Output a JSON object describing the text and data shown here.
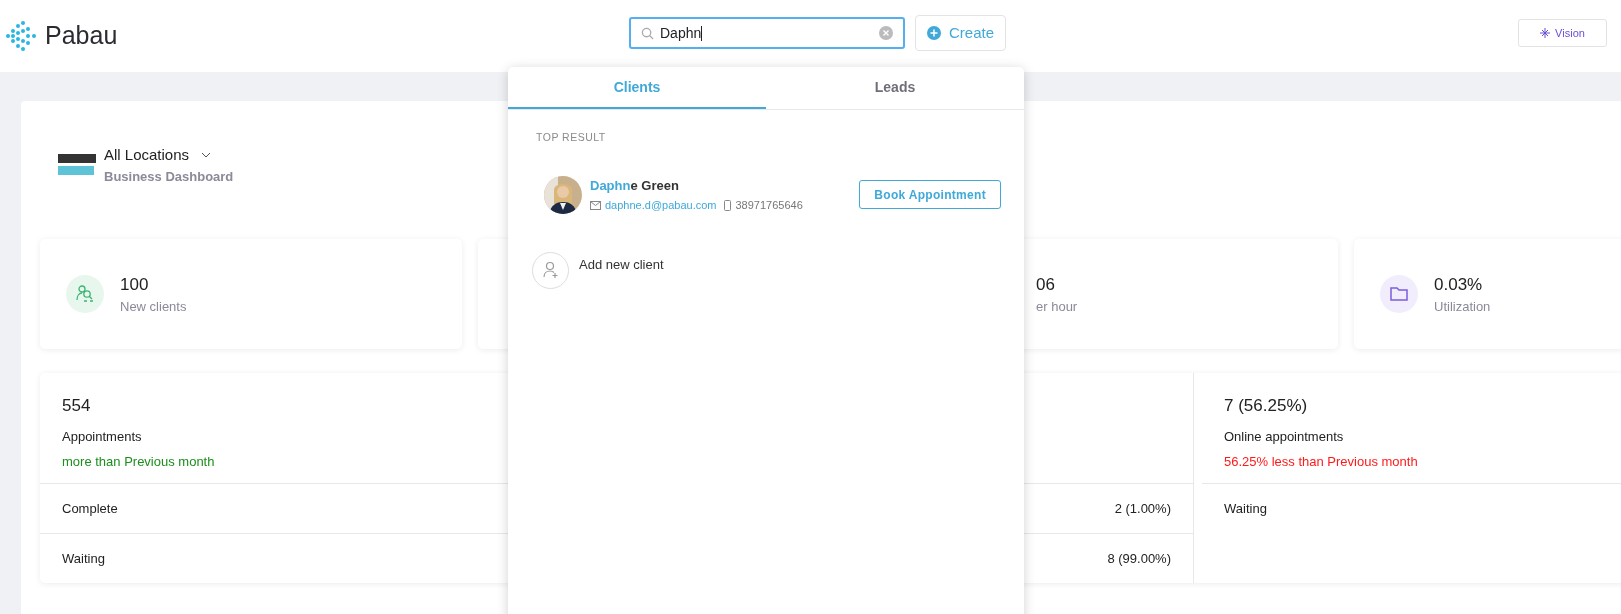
{
  "header": {
    "brand": "Pabau",
    "search": {
      "value": "Daphn"
    },
    "create_button": "Create",
    "vision_button": "Vision"
  },
  "location": {
    "title": "All Locations",
    "subtitle": "Business Dashboard"
  },
  "stat_cards": [
    {
      "value": "100",
      "label": "New clients"
    },
    {
      "value": "06",
      "label": "er hour"
    },
    {
      "value": "0.03%",
      "label": "Utilization"
    }
  ],
  "summaries": [
    {
      "value": "554",
      "label": "Appointments",
      "trend_text": "more than Previous month",
      "color": "#1a8f1a",
      "rows": [
        {
          "label": "Complete",
          "value": "2 (1.00%)"
        },
        {
          "label": "Waiting",
          "value": "8 (99.00%)"
        }
      ]
    },
    {
      "value": "7 (56.25%)",
      "label": "Online appointments",
      "trend_text": "56.25% less than Previous month",
      "color": "#ff1a1a",
      "rows": [
        {
          "label": "Waiting"
        }
      ]
    }
  ],
  "search_dropdown": {
    "tabs": [
      {
        "label": "Clients",
        "selected": true
      },
      {
        "label": "Leads",
        "selected": false
      }
    ],
    "section_title": "TOP RESULT",
    "result": {
      "name_parts": [
        {
          "text": "Daphn",
          "highlighted": true
        },
        {
          "text": "e Green",
          "highlighted": false
        }
      ],
      "email": "daphne.d@pabau.com",
      "phone": "38971765646",
      "action": "Book Appointment"
    },
    "add_new": "Add new client"
  }
}
